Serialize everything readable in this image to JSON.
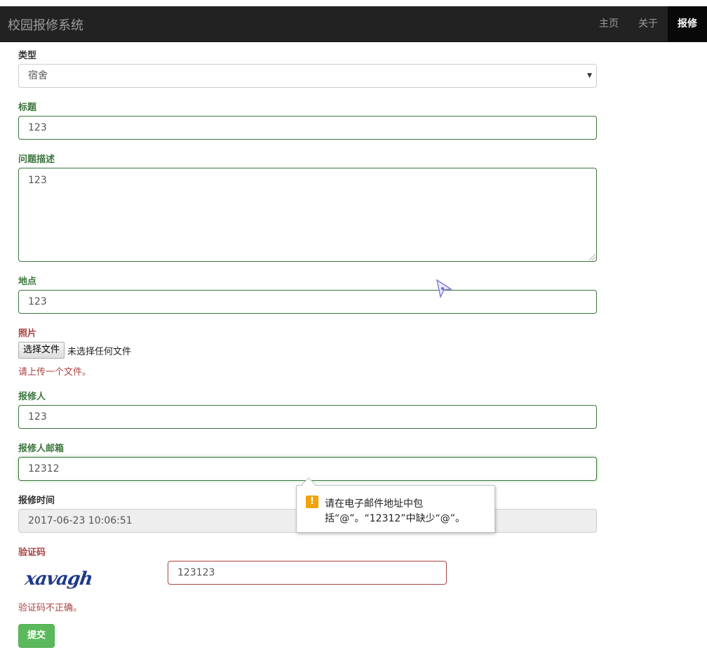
{
  "app": {
    "brand": "校园报修系统"
  },
  "nav": {
    "items": [
      {
        "label": "主页"
      },
      {
        "label": "关于"
      },
      {
        "label": "报修",
        "active": true
      }
    ]
  },
  "form": {
    "type": {
      "label": "类型",
      "value": "宿舍"
    },
    "title": {
      "label": "标题",
      "value": "123"
    },
    "description": {
      "label": "问题描述",
      "value": "123"
    },
    "location": {
      "label": "地点",
      "value": "123"
    },
    "photo": {
      "label": "照片",
      "button": "选择文件",
      "status": "未选择任何文件",
      "error": "请上传一个文件。"
    },
    "reporter": {
      "label": "报修人",
      "value": "123"
    },
    "email": {
      "label": "报修人邮箱",
      "value": "12312"
    },
    "time": {
      "label": "报修时间",
      "value": "2017-06-23 10:06:51"
    },
    "captcha": {
      "label": "验证码",
      "image_text": "xavagh",
      "value": "123123",
      "error": "验证码不正确。"
    },
    "submit": "提交"
  },
  "tooltip": {
    "icon": "!",
    "message": "请在电子邮件地址中包括“@”。“12312”中缺少“@”。"
  },
  "colors": {
    "success": "#3c763d",
    "error": "#a94442",
    "submit": "#5cb85c",
    "navbar": "#222222"
  }
}
